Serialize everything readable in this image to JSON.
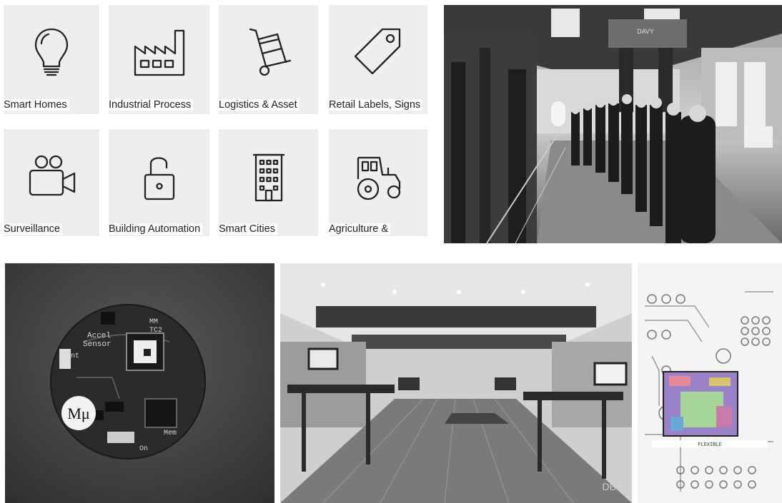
{
  "tiles": [
    {
      "label": "Smart Homes",
      "icon": "light-bulb-icon"
    },
    {
      "label": "Industrial Process Control",
      "icon": "factory-icon"
    },
    {
      "label": "Logistics & Asset Management",
      "icon": "hand-truck-icon"
    },
    {
      "label": "Retail Labels, Signs & Scanners",
      "icon": "price-tag-icon"
    },
    {
      "label": "Surveillance Systems",
      "icon": "video-camera-icon"
    },
    {
      "label": "Building Automation",
      "icon": "open-padlock-icon"
    },
    {
      "label": "Smart Cities",
      "icon": "building-icon"
    },
    {
      "label": "Agriculture & Environmental",
      "icon": "tractor-icon"
    }
  ],
  "photos": {
    "factory_team": {
      "sign_text": "DAVY"
    },
    "sensor_board": {
      "logo_text": "Mμ",
      "silkscreen": [
        "MM",
        "TC2",
        "Accel",
        "Sensor",
        "Ant",
        "Mem",
        "On"
      ]
    },
    "office": {
      "watermark": "DB"
    },
    "chip_layout": {
      "label": "FLEXIBLE"
    }
  }
}
